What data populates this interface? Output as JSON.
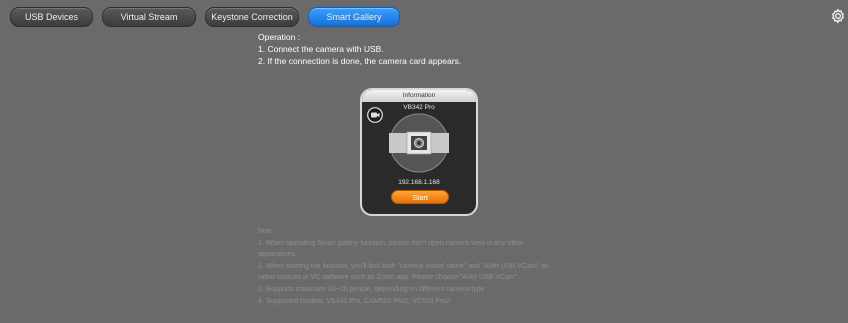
{
  "tabs": [
    {
      "label": "USB Devices",
      "active": false
    },
    {
      "label": "Virtual Stream",
      "active": false
    },
    {
      "label": "Keystone Correction",
      "active": false
    },
    {
      "label": "Smart Gallery",
      "active": true
    }
  ],
  "settings": {
    "icon": "gear-icon"
  },
  "operation": {
    "title": "Operation :",
    "steps": [
      "1. Connect the camera with USB.",
      "2. If the connection is done, the camera card appears."
    ]
  },
  "card": {
    "header": "Information",
    "model": "VB342 Pro",
    "ip": "192.168.1.168",
    "start_label": "Start",
    "camera_icon": "camera-icon"
  },
  "note": {
    "title": "Note",
    "lines": [
      "1. When operating Smart gallery function, please don't open camera view in any other",
      "applications.",
      "2. When starting the function, you'll find both \"camera model name\" and \"AVer USB VCam\" as",
      "video sources in VC software such as Zoom app. Please choose \"AVer USB VCam\".",
      "3. Supports maximum 10~20 people, depending on different camera type",
      "4. Supported models: VB342 Pro, CAM520 Pro2, VC520 Pro2"
    ]
  },
  "colors": {
    "background": "#6a6a6a",
    "tab_active": "#1e88f0",
    "start_button": "#f58a12"
  }
}
